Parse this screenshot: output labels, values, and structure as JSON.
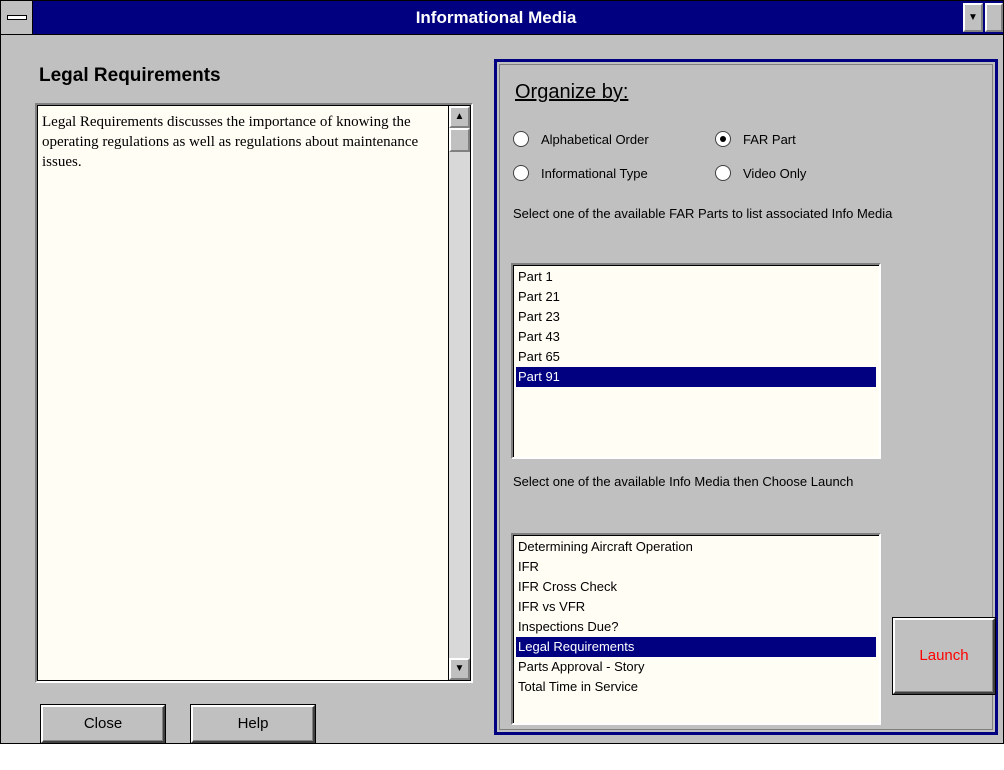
{
  "window": {
    "title": "Informational Media"
  },
  "titlebar_icons": {
    "sysmenu": "system-menu-icon",
    "minimize": "minimize-arrow-icon"
  },
  "left": {
    "heading": "Legal Requirements",
    "description": "Legal Requirements discusses the importance of knowing the operating regulations as well as regulations about maintenance issues."
  },
  "buttons": {
    "close": "Close",
    "help": "Help",
    "launch": "Launch"
  },
  "colors": {
    "titlebar": "#000080",
    "selection": "#000080",
    "launch_text": "#ff0000",
    "list_bg": "#fffdf4"
  },
  "organize": {
    "heading": "Organize by:",
    "options": [
      {
        "label": "Alphabetical Order",
        "selected": false
      },
      {
        "label": "FAR Part",
        "selected": true
      },
      {
        "label": "Informational Type",
        "selected": false
      },
      {
        "label": "Video Only",
        "selected": false
      }
    ]
  },
  "far_parts": {
    "instruction": "Select one of the available FAR Parts to list associated Info Media",
    "items": [
      "Part 1",
      "Part 21",
      "Part 23",
      "Part 43",
      "Part 65",
      "Part 91"
    ],
    "selected_index": 5
  },
  "media": {
    "instruction": "Select one of the available Info Media then Choose Launch",
    "items": [
      "Determining Aircraft Operation",
      "IFR",
      "IFR Cross Check",
      "IFR vs VFR",
      "Inspections Due?",
      "Legal Requirements",
      "Parts Approval - Story",
      "Total Time in Service"
    ],
    "selected_index": 5
  }
}
